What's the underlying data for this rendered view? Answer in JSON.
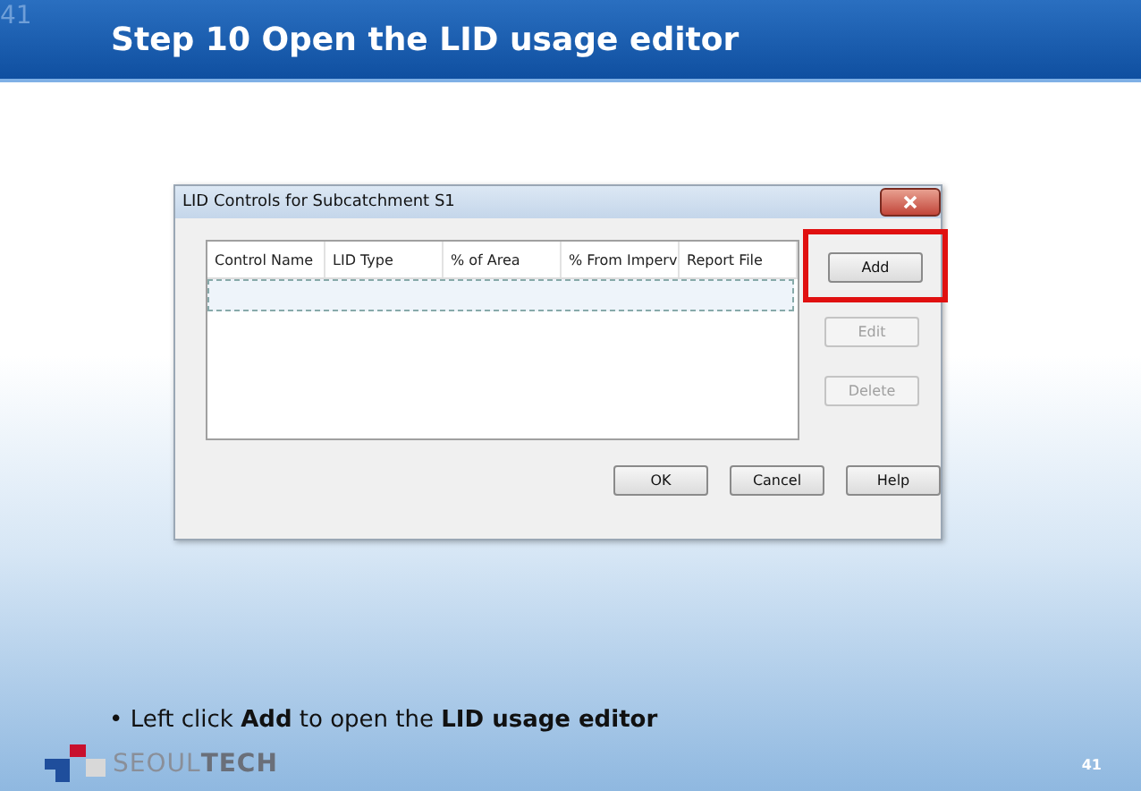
{
  "corner_number": "41",
  "title": "Step 10 Open the LID usage editor",
  "dialog": {
    "title": "LID Controls for Subcatchment S1",
    "columns": [
      "Control Name",
      "LID Type",
      "% of Area",
      "% From Imperv",
      "Report File"
    ],
    "side_buttons": [
      {
        "label": "Add",
        "disabled": false,
        "highlighted": true
      },
      {
        "label": "Edit",
        "disabled": true,
        "highlighted": false
      },
      {
        "label": "Delete",
        "disabled": true,
        "highlighted": false
      }
    ],
    "bottom_buttons": [
      "OK",
      "Cancel",
      "Help"
    ]
  },
  "bullet_mark": "•",
  "bullet": "Left click **Add** to open the **LID usage editor**",
  "logo": "SEOUL**TECH**",
  "page_number": "41"
}
